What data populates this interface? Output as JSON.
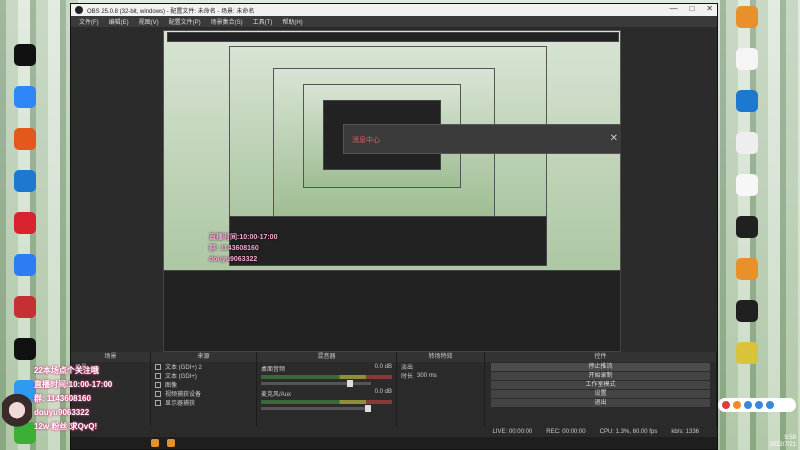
{
  "window": {
    "title": "OBS 25.0.8 (32-bit, windows) - 配置文件: 未命名 - 场景: 未命名",
    "controls": [
      "—",
      "□",
      "✕"
    ]
  },
  "menu": [
    "文件(F)",
    "编辑(E)",
    "视图(V)",
    "配置文件(P)",
    "场景集合(S)",
    "工具(T)",
    "帮助(H)"
  ],
  "popup_title": "消息中心",
  "docks": {
    "scenes": {
      "header": "场景",
      "items": [
        "场景"
      ]
    },
    "sources": {
      "header": "来源",
      "items": [
        "文本 (GDI+) 2",
        "文本 (GDI+)",
        "图像",
        "视频捕获设备",
        "显示器捕获"
      ]
    },
    "mixer": {
      "header": "混音器",
      "rows": [
        {
          "name": "桌面音频",
          "db": "0.0 dB"
        },
        {
          "name": "麦克风/Aux",
          "db": "0.0 dB"
        }
      ]
    },
    "transitions": {
      "header": "转场特效",
      "type": "淡出",
      "duration_label": "时长",
      "duration_value": "300 ms"
    },
    "controls": {
      "header": "控件",
      "buttons": [
        "停止推流",
        "开始录制",
        "工作室模式",
        "设置",
        "退出"
      ]
    }
  },
  "status": {
    "live": "LIVE: 00:00:00",
    "rec": "REC: 00:00:00",
    "cpu": "CPU: 1.3%, 60.00 fps",
    "kbps": "kb/s: 1336"
  },
  "tray": {
    "time": "9:59",
    "date": "2022/7/21"
  },
  "overlay": {
    "lines": [
      "22本场点个关注哦",
      "直播时间:10:00-17:00",
      "群: 1143608160",
      "douyu9063322",
      "12w 粉丝 求QvQ!"
    ]
  },
  "desktop_left": [
    {
      "label": "",
      "icon": "capcut-icon",
      "color": "#111111"
    },
    {
      "label": "",
      "icon": "baidu-netdisk-icon",
      "color": "#2f86f6"
    },
    {
      "label": "",
      "icon": "tencent-game-icon",
      "color": "#e5581c"
    },
    {
      "label": "",
      "icon": "ie-icon",
      "color": "#1d78d0"
    },
    {
      "label": "",
      "icon": "netease-music-icon",
      "color": "#d7232d"
    },
    {
      "label": "",
      "icon": "qq-browser-icon",
      "color": "#2d7cf4"
    },
    {
      "label": "",
      "icon": "jianying-icon",
      "color": "#c73033"
    },
    {
      "label": "",
      "icon": "douyin-icon",
      "color": "#111111"
    },
    {
      "label": "",
      "icon": "qq-icon",
      "color": "#2f9bf0"
    },
    {
      "label": "",
      "icon": "wechat-icon",
      "color": "#3cb035"
    }
  ],
  "desktop_right": [
    {
      "label": "",
      "icon": "folder-icon",
      "color": "#e8912b"
    },
    {
      "label": "",
      "icon": "docx-icon",
      "color": "#f5f5f5"
    },
    {
      "label": "",
      "icon": "ie-icon",
      "color": "#1d78d0"
    },
    {
      "label": "",
      "icon": "png-file-icon",
      "color": "#eeeeee"
    },
    {
      "label": "",
      "icon": "text-file-icon",
      "color": "#f7f7f7"
    },
    {
      "label": "",
      "icon": "obs-icon",
      "color": "#202020"
    },
    {
      "label": "",
      "icon": "app-icon",
      "color": "#e8912b"
    },
    {
      "label": "",
      "icon": "obs-icon",
      "color": "#202020"
    },
    {
      "label": "",
      "icon": "app-icon",
      "color": "#d8c33a"
    }
  ]
}
